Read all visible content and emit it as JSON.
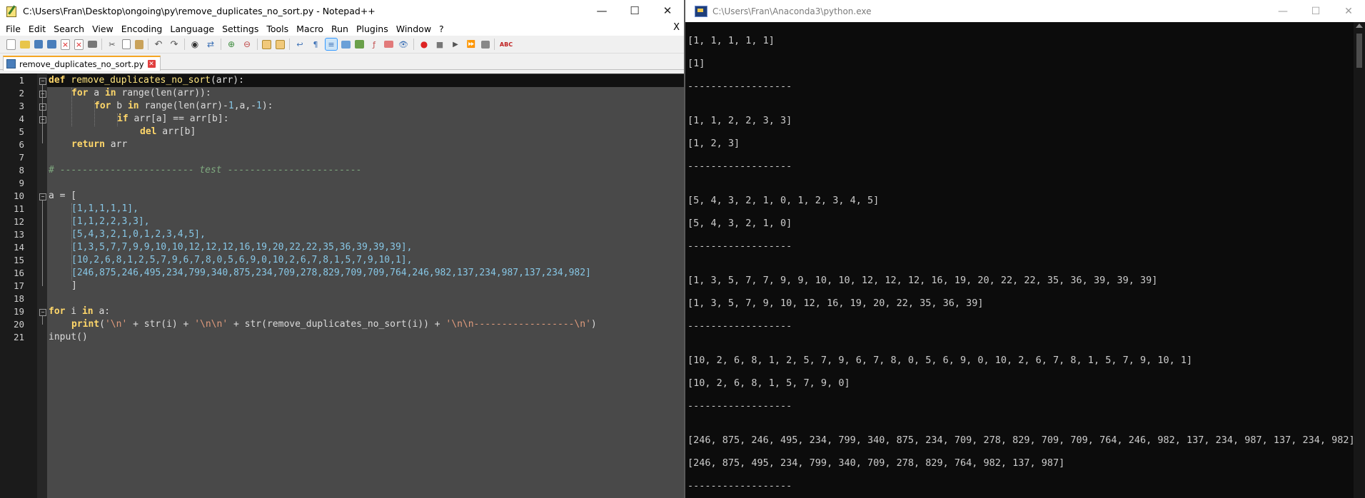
{
  "npp": {
    "title": "C:\\Users\\Fran\\Desktop\\ongoing\\py\\remove_duplicates_no_sort.py - Notepad++",
    "menu": [
      "File",
      "Edit",
      "Search",
      "View",
      "Encoding",
      "Language",
      "Settings",
      "Tools",
      "Macro",
      "Run",
      "Plugins",
      "Window",
      "?"
    ],
    "menu_close": "X",
    "tab_label": "remove_duplicates_no_sort.py",
    "line_numbers": [
      "1",
      "2",
      "3",
      "4",
      "5",
      "6",
      "7",
      "8",
      "9",
      "10",
      "11",
      "12",
      "13",
      "14",
      "15",
      "16",
      "17",
      "18",
      "19",
      "20",
      "21"
    ],
    "code": {
      "l1_kw": "def",
      "l1_fn": " remove_duplicates_no_sort",
      "l1_rest": "(arr):",
      "l2_kw": "for",
      "l2_a": " a ",
      "l2_in": "in",
      "l2_rest": " range(len(arr)):",
      "l3_kw": "for",
      "l3_a": " b ",
      "l3_in": "in",
      "l3_b": " range(len(arr)-",
      "l3_n1": "1",
      "l3_c": ",a,-",
      "l3_n2": "1",
      "l3_d": "):",
      "l4_kw": "if",
      "l4_rest": " arr[a] == arr[b]:",
      "l5_kw": "del",
      "l5_rest": " arr[b]",
      "l6_kw": "return",
      "l6_rest": " arr",
      "l8_a": "# ------------------------ ",
      "l8_b": "test",
      "l8_c": " ------------------------",
      "l10": "a = [",
      "l11": "[1,1,1,1,1],",
      "l12": "[1,1,2,2,3,3],",
      "l13": "[5,4,3,2,1,0,1,2,3,4,5],",
      "l14": "[1,3,5,7,7,9,9,10,10,12,12,12,16,19,20,22,22,35,36,39,39,39],",
      "l15": "[10,2,6,8,1,2,5,7,9,6,7,8,0,5,6,9,0,10,2,6,7,8,1,5,7,9,10,1],",
      "l16": "[246,875,246,495,234,799,340,875,234,709,278,829,709,709,764,246,982,137,234,987,137,234,982]",
      "l17": "]",
      "l19_kw": "for",
      "l19_a": " i ",
      "l19_in": "in",
      "l19_rest": " a:",
      "l20_kw": "print",
      "l20_a": "(",
      "l20_s1": "'\\n'",
      "l20_b": " + str(i) + ",
      "l20_s2": "'\\n\\n'",
      "l20_c": " + str(remove_duplicates_no_sort(i)) + ",
      "l20_s3": "'\\n\\n------------------\\n'",
      "l20_d": ")",
      "l21": "input()"
    }
  },
  "console": {
    "title": "C:\\Users\\Fran\\Anaconda3\\python.exe",
    "lines": [
      "[1, 1, 1, 1, 1]",
      "[1]",
      "------------------",
      "[1, 1, 2, 2, 3, 3]",
      "[1, 2, 3]",
      "------------------",
      "[5, 4, 3, 2, 1, 0, 1, 2, 3, 4, 5]",
      "[5, 4, 3, 2, 1, 0]",
      "------------------",
      "[1, 3, 5, 7, 7, 9, 9, 10, 10, 12, 12, 12, 16, 19, 20, 22, 22, 35, 36, 39, 39, 39]",
      "[1, 3, 5, 7, 9, 10, 12, 16, 19, 20, 22, 35, 36, 39]",
      "------------------",
      "[10, 2, 6, 8, 1, 2, 5, 7, 9, 6, 7, 8, 0, 5, 6, 9, 0, 10, 2, 6, 7, 8, 1, 5, 7, 9, 10, 1]",
      "[10, 2, 6, 8, 1, 5, 7, 9, 0]",
      "------------------",
      "[246, 875, 246, 495, 234, 799, 340, 875, 234, 709, 278, 829, 709, 709, 764, 246, 982, 137, 234, 987, 137, 234, 982]",
      "[246, 875, 495, 234, 799, 340, 709, 278, 829, 764, 982, 137, 987]",
      "------------------"
    ]
  },
  "colors": {
    "editor_bg": "#494949",
    "keyword": "#ffd76a",
    "number": "#87c7e6",
    "string": "#e09b7c",
    "comment": "#7fa97f",
    "console_bg": "#0c0c0c",
    "console_text": "#cccccc"
  }
}
